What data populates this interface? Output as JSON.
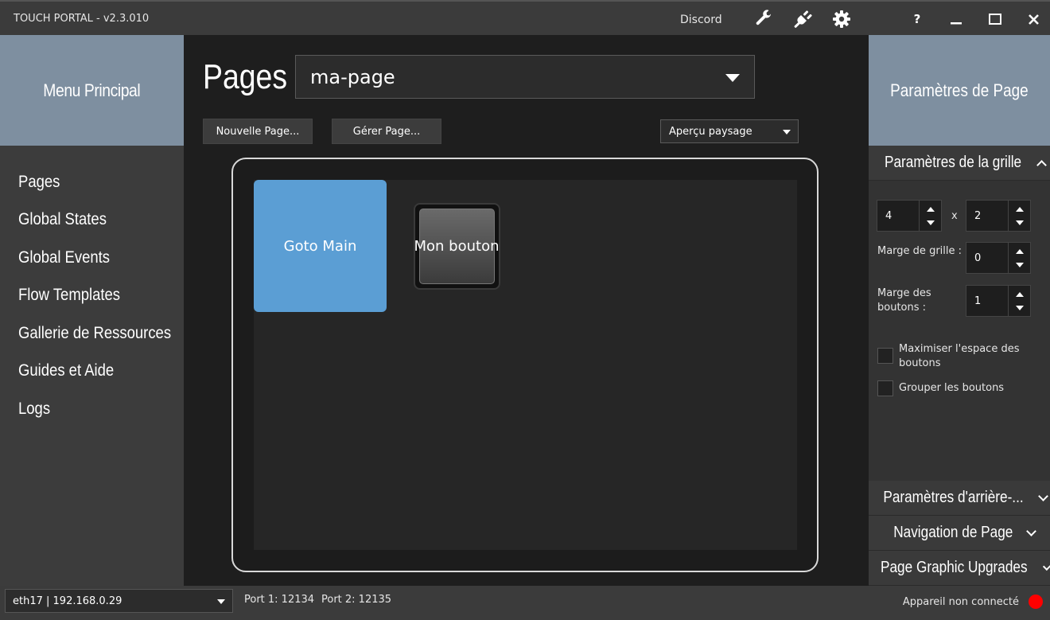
{
  "titlebar": {
    "app_title": "TOUCH PORTAL - v2.3.010",
    "discord_label": "Discord",
    "help_label": "?",
    "icons": [
      "wrench-icon",
      "plug-icon",
      "gear-icon",
      "help-icon",
      "minimize-icon",
      "maximize-icon",
      "close-icon"
    ]
  },
  "sidebar": {
    "header": "Menu Principal",
    "items": [
      {
        "label": "Pages"
      },
      {
        "label": "Global States"
      },
      {
        "label": "Global Events"
      },
      {
        "label": "Flow Templates"
      },
      {
        "label": "Gallerie de Ressources"
      },
      {
        "label": "Guides et Aide"
      },
      {
        "label": "Logs"
      }
    ]
  },
  "main": {
    "title": "Pages",
    "page_select_value": "ma-page",
    "new_page_label": "Nouvelle Page...",
    "manage_page_label": "Gérer Page...",
    "preview_select_value": "Aperçu paysage",
    "tiles": [
      {
        "label": "Goto Main",
        "color": "#5b9ed4"
      },
      {
        "label": "Mon bouton"
      }
    ]
  },
  "right_panel": {
    "header": "Paramètres de Page",
    "grid_section": {
      "title": "Paramètres de la grille",
      "columns": "4",
      "separator": "x",
      "rows": "2",
      "grid_margin_label": "Marge de grille :",
      "grid_margin_value": "0",
      "button_margin_label_1": "Marge des",
      "button_margin_label_2": "boutons :",
      "button_margin_value": "1",
      "maximize_label_1": "Maximiser l'espace des",
      "maximize_label_2": "boutons",
      "group_label": "Grouper les boutons"
    },
    "sections": [
      {
        "label": "Paramètres d'arrière-..."
      },
      {
        "label": "Navigation de Page"
      },
      {
        "label": "Page Graphic Upgrades"
      }
    ]
  },
  "statusbar": {
    "network_value": "eth17 | 192.168.0.29",
    "port1": "Port 1: 12134",
    "port2": "Port 2: 12135",
    "connection_status": "Appareil non connecté",
    "status_color": "#ff0000"
  }
}
